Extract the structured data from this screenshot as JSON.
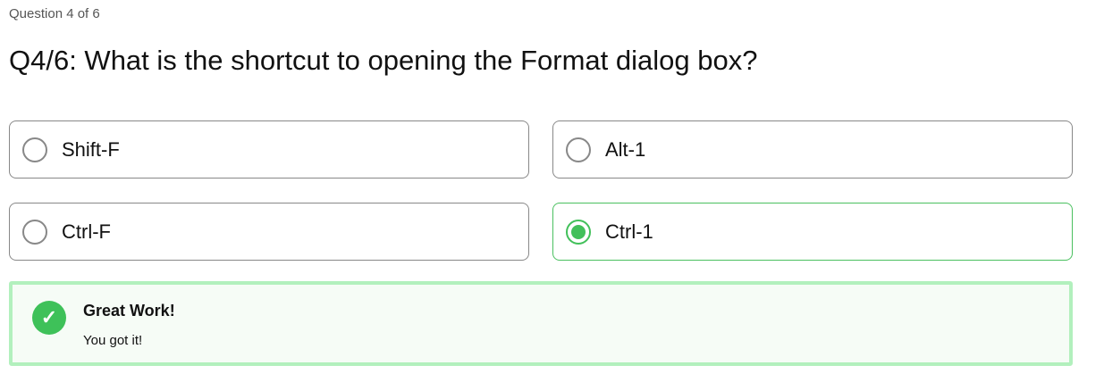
{
  "progress": "Question 4 of 6",
  "question": "Q4/6: What is the shortcut to opening the Format dialog box?",
  "options": [
    {
      "label": "Shift-F",
      "selected": false
    },
    {
      "label": "Alt-1",
      "selected": false
    },
    {
      "label": "Ctrl-F",
      "selected": false
    },
    {
      "label": "Ctrl-1",
      "selected": true
    }
  ],
  "feedback": {
    "title": "Great Work!",
    "message": "You got it!",
    "icon": "check-icon"
  },
  "colors": {
    "accent": "#42c05a",
    "feedback_border": "#b2f0bd",
    "feedback_bg": "#f6fcf6"
  }
}
